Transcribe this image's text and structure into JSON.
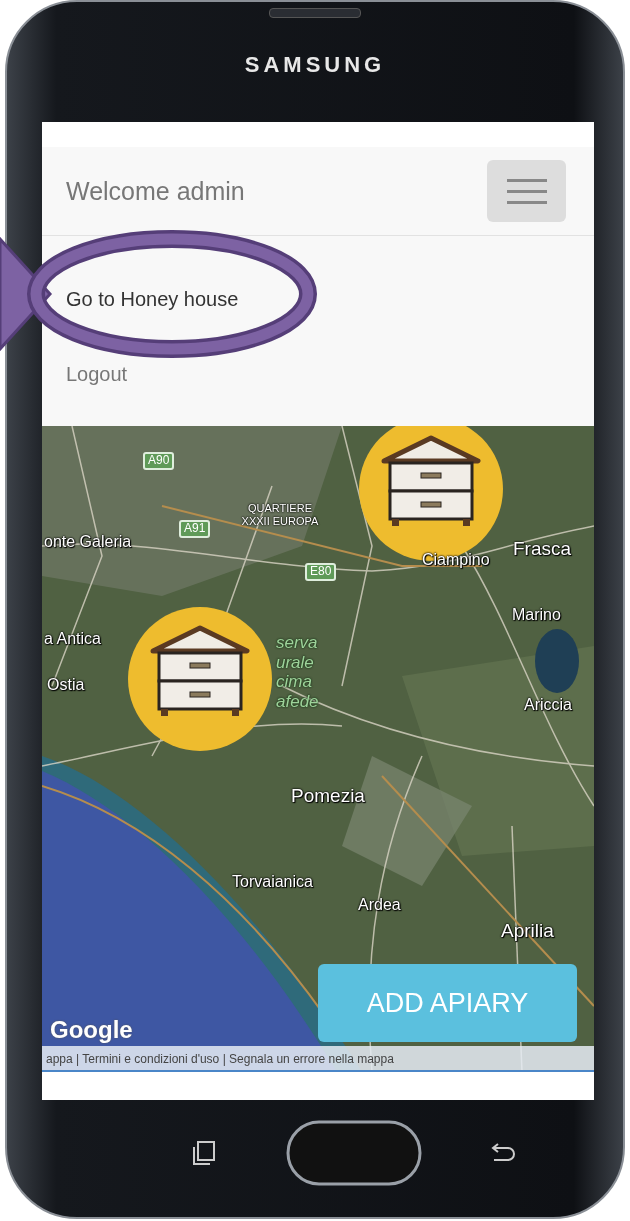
{
  "device": {
    "brand": "SAMSUNG"
  },
  "navbar": {
    "title": "Welcome admin"
  },
  "menu": [
    {
      "label": "Go to Honey house",
      "highlighted": true
    },
    {
      "label": "Logout",
      "highlighted": false
    }
  ],
  "map": {
    "labels": [
      {
        "text": "A90",
        "kind": "road"
      },
      {
        "text": "QUARTIERE XXXII EUROPA",
        "kind": "district"
      },
      {
        "text": "A91",
        "kind": "road"
      },
      {
        "text": "onte Galeria",
        "kind": "place"
      },
      {
        "text": "E80",
        "kind": "road"
      },
      {
        "text": "Ciampino",
        "kind": "place"
      },
      {
        "text": "Frasca",
        "kind": "city"
      },
      {
        "text": "Marino",
        "kind": "place"
      },
      {
        "text": "a Antica",
        "kind": "place"
      },
      {
        "text": "Ostia",
        "kind": "place"
      },
      {
        "text": "serva urale cima afede",
        "kind": "park"
      },
      {
        "text": "Ariccia",
        "kind": "place"
      },
      {
        "text": "Pomezia",
        "kind": "city"
      },
      {
        "text": "Torvaianica",
        "kind": "place"
      },
      {
        "text": "Ardea",
        "kind": "place"
      },
      {
        "text": "Aprilia",
        "kind": "city"
      }
    ],
    "markers": [
      {
        "kind": "beehive"
      },
      {
        "kind": "beehive"
      }
    ],
    "logo": "Google",
    "attribution": "appa | Termini e condizioni d'uso | Segnala un errore nella mappa",
    "button": "ADD APIARY"
  }
}
